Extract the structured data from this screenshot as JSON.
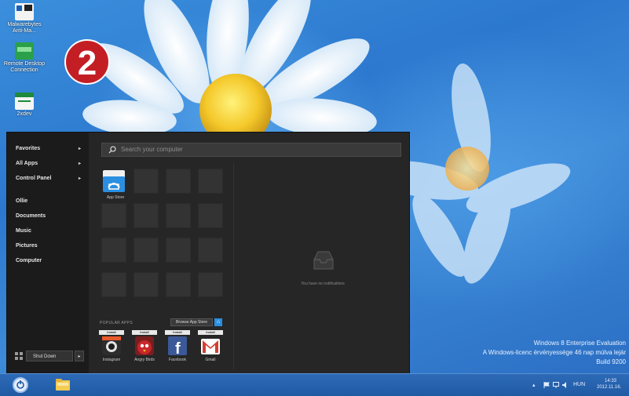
{
  "desktop": {
    "icons": [
      {
        "label": "Malwarebytes Anti-Ma...",
        "icon": "shortcut-icon"
      },
      {
        "label": "Remote Desktop Connection",
        "icon": "network-icon"
      },
      {
        "label": "2xdev",
        "icon": "spreadsheet-icon"
      }
    ],
    "badge": "2",
    "watermark": {
      "line1": "Windows 8 Enterprise Evaluation",
      "line2": "A Windows-licenc érvényessége 46 nap múlva lejár",
      "line3": "Build 9200"
    }
  },
  "start_menu": {
    "nav": [
      {
        "label": "Favorites",
        "arrow": "▸"
      },
      {
        "label": "All Apps",
        "arrow": "▸"
      },
      {
        "label": "Control Panel",
        "arrow": "▸"
      },
      {
        "label": "Ollie",
        "arrow": ""
      },
      {
        "label": "Documents",
        "arrow": ""
      },
      {
        "label": "Music",
        "arrow": ""
      },
      {
        "label": "Pictures",
        "arrow": ""
      },
      {
        "label": "Computer",
        "arrow": ""
      }
    ],
    "search_placeholder": "Search your computer",
    "pinned_app": "App Store",
    "notifications_text": "You have no notifications",
    "popular_title": "POPULAR APPS",
    "browse_button": "Browse App Store",
    "popular_apps": [
      {
        "name": "Instagram",
        "install": "Install",
        "color": "#2d2d2d"
      },
      {
        "name": "Angry Birds",
        "install": "Install",
        "color": "#c8262b"
      },
      {
        "name": "Facebook",
        "install": "Install",
        "color": "#3b5998"
      },
      {
        "name": "Gmail",
        "install": "Install",
        "color": "#ffffff"
      }
    ],
    "shutdown_label": "Shut Down",
    "shutdown_arrow": "▸"
  },
  "taskbar": {
    "tray_arrow": "▴",
    "language": "HUN",
    "time": "14:33",
    "date": "2012.11.16."
  },
  "colors": {
    "accent": "#2a8fe0",
    "badge": "#c41e25",
    "menu_bg": "#262627"
  }
}
